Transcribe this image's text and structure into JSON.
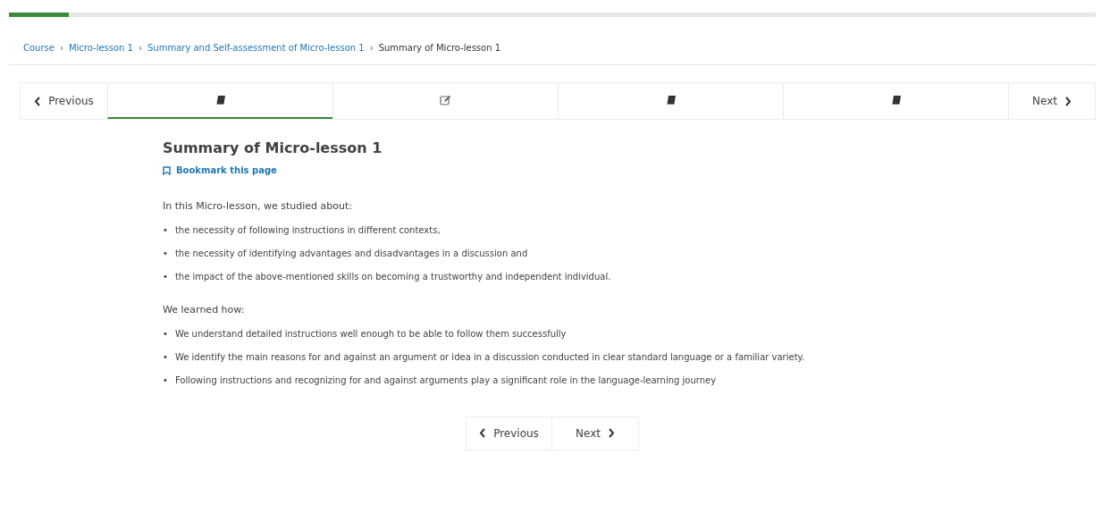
{
  "progress": {
    "level": 0.055
  },
  "breadcrumb": [
    {
      "label": "Course",
      "link": true
    },
    {
      "separator": "›",
      "label": "Micro-lesson 1",
      "link": true
    },
    {
      "separator": "›",
      "label": "Summary and Self-assessment of Micro-lesson 1",
      "link": true
    },
    {
      "separator": "›",
      "label": "Summary of Micro-lesson 1",
      "link": false
    }
  ],
  "sequence_nav": {
    "previous": "Previous",
    "next": "Next",
    "units": [
      {
        "kind": "book",
        "selected": true
      },
      {
        "kind": "edit",
        "selected": false
      },
      {
        "kind": "book",
        "selected": false
      },
      {
        "kind": "book",
        "selected": false
      }
    ]
  },
  "title": "Summary of Micro-lesson 1",
  "bookmark": "Bookmark this page",
  "content": [
    {
      "kind": "paragraph",
      "text": "In this Micro-lesson, we studied about:"
    },
    {
      "kind": "list",
      "marker": "•",
      "items": [
        "the necessity of following instructions in different contexts,",
        "the necessity of identifying advantages and disadvantages in a discussion and",
        "the impact of the above-mentioned skills on becoming a trustworthy and independent individual."
      ]
    },
    {
      "kind": "paragraph",
      "text": "We learned how:"
    },
    {
      "kind": "list",
      "marker": "•",
      "items": [
        "We understand detailed instructions well enough to be able to follow them successfully",
        "We identify the main reasons for and against an argument or idea in a discussion conducted in clear standard language or a familiar variety.",
        "Following instructions and recognizing for and against arguments play a significant role in the language-learning journey"
      ]
    }
  ],
  "bottom_nav": {
    "previous": "Previous",
    "next": "Next"
  }
}
